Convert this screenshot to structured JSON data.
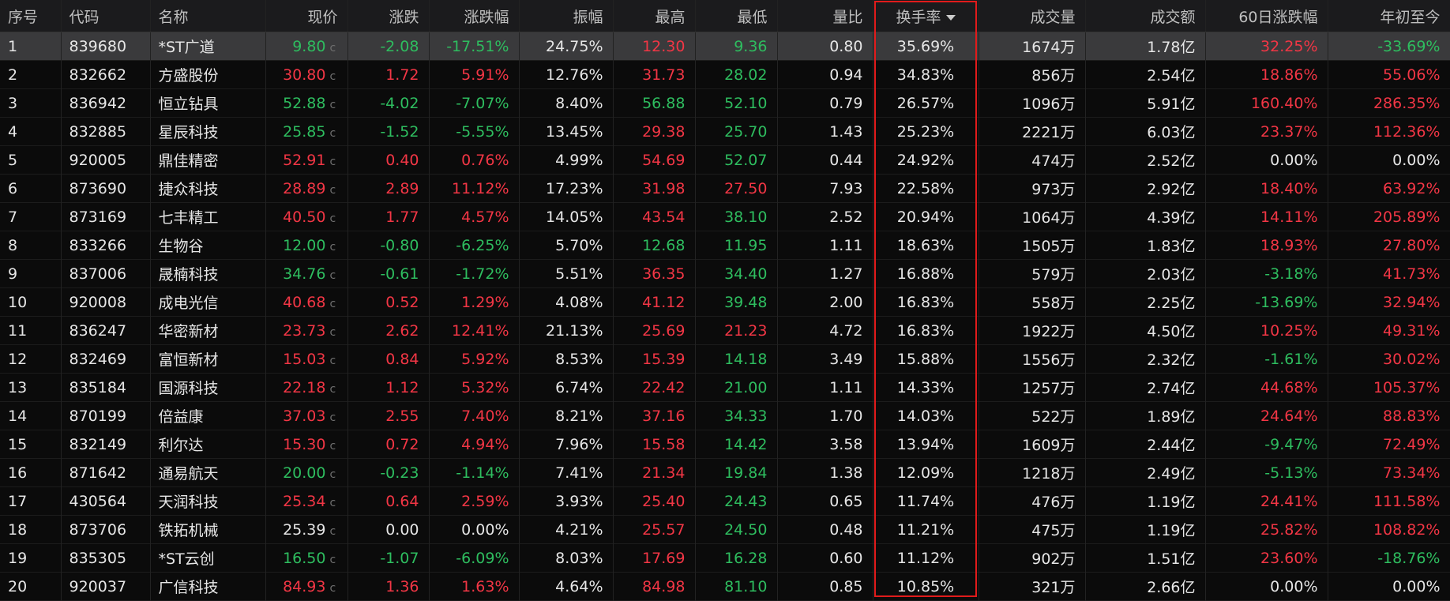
{
  "columns": {
    "idx": "序号",
    "code": "代码",
    "name": "名称",
    "price": "现价",
    "change": "涨跌",
    "change_pct": "涨跌幅",
    "amplitude": "振幅",
    "high": "最高",
    "low": "最低",
    "vol_ratio": "量比",
    "turnover": "换手率",
    "volume": "成交量",
    "amount": "成交额",
    "chg60": "60日涨跌幅",
    "ytd": "年初至今"
  },
  "sorted_column": "turnover",
  "sort_direction": "desc",
  "colors": {
    "up": "#f23645",
    "down": "#2ebd5f",
    "flat": "#e6e6e6",
    "highlight_box": "#e11b1b"
  },
  "rows": [
    {
      "idx": "1",
      "code": "839680",
      "name": "*ST广道",
      "price": "9.80",
      "price_tag": "c",
      "change": "-2.08",
      "change_pct": "-17.51%",
      "amplitude": "24.75%",
      "high": "12.30",
      "low": "9.36",
      "vol_ratio": "0.80",
      "turnover": "35.69%",
      "volume": "1674万",
      "amount": "1.78亿",
      "chg60": "32.25%",
      "ytd": "-33.69%"
    },
    {
      "idx": "2",
      "code": "832662",
      "name": "方盛股份",
      "price": "30.80",
      "price_tag": "c",
      "change": "1.72",
      "change_pct": "5.91%",
      "amplitude": "12.76%",
      "high": "31.73",
      "low": "28.02",
      "vol_ratio": "0.94",
      "turnover": "34.83%",
      "volume": "856万",
      "amount": "2.54亿",
      "chg60": "18.86%",
      "ytd": "55.06%"
    },
    {
      "idx": "3",
      "code": "836942",
      "name": "恒立钻具",
      "price": "52.88",
      "price_tag": "c",
      "change": "-4.02",
      "change_pct": "-7.07%",
      "amplitude": "8.40%",
      "high": "56.88",
      "low": "52.10",
      "vol_ratio": "0.79",
      "turnover": "26.57%",
      "volume": "1096万",
      "amount": "5.91亿",
      "chg60": "160.40%",
      "ytd": "286.35%"
    },
    {
      "idx": "4",
      "code": "832885",
      "name": "星辰科技",
      "price": "25.85",
      "price_tag": "c",
      "change": "-1.52",
      "change_pct": "-5.55%",
      "amplitude": "13.45%",
      "high": "29.38",
      "low": "25.70",
      "vol_ratio": "1.43",
      "turnover": "25.23%",
      "volume": "2221万",
      "amount": "6.03亿",
      "chg60": "23.37%",
      "ytd": "112.36%"
    },
    {
      "idx": "5",
      "code": "920005",
      "name": "鼎佳精密",
      "price": "52.91",
      "price_tag": "c",
      "change": "0.40",
      "change_pct": "0.76%",
      "amplitude": "4.99%",
      "high": "54.69",
      "low": "52.07",
      "vol_ratio": "0.44",
      "turnover": "24.92%",
      "volume": "474万",
      "amount": "2.52亿",
      "chg60": "0.00%",
      "ytd": "0.00%"
    },
    {
      "idx": "6",
      "code": "873690",
      "name": "捷众科技",
      "price": "28.89",
      "price_tag": "c",
      "change": "2.89",
      "change_pct": "11.12%",
      "amplitude": "17.23%",
      "high": "31.98",
      "low": "27.50",
      "vol_ratio": "7.93",
      "turnover": "22.58%",
      "volume": "973万",
      "amount": "2.92亿",
      "chg60": "18.40%",
      "ytd": "63.92%"
    },
    {
      "idx": "7",
      "code": "873169",
      "name": "七丰精工",
      "price": "40.50",
      "price_tag": "c",
      "change": "1.77",
      "change_pct": "4.57%",
      "amplitude": "14.05%",
      "high": "43.54",
      "low": "38.10",
      "vol_ratio": "2.52",
      "turnover": "20.94%",
      "volume": "1064万",
      "amount": "4.39亿",
      "chg60": "14.11%",
      "ytd": "205.89%"
    },
    {
      "idx": "8",
      "code": "833266",
      "name": "生物谷",
      "price": "12.00",
      "price_tag": "c",
      "change": "-0.80",
      "change_pct": "-6.25%",
      "amplitude": "5.70%",
      "high": "12.68",
      "low": "11.95",
      "vol_ratio": "1.11",
      "turnover": "18.63%",
      "volume": "1505万",
      "amount": "1.83亿",
      "chg60": "18.93%",
      "ytd": "27.80%"
    },
    {
      "idx": "9",
      "code": "837006",
      "name": "晟楠科技",
      "price": "34.76",
      "price_tag": "c",
      "change": "-0.61",
      "change_pct": "-1.72%",
      "amplitude": "5.51%",
      "high": "36.35",
      "low": "34.40",
      "vol_ratio": "1.27",
      "turnover": "16.88%",
      "volume": "579万",
      "amount": "2.03亿",
      "chg60": "-3.18%",
      "ytd": "41.73%"
    },
    {
      "idx": "10",
      "code": "920008",
      "name": "成电光信",
      "price": "40.68",
      "price_tag": "c",
      "change": "0.52",
      "change_pct": "1.29%",
      "amplitude": "4.08%",
      "high": "41.12",
      "low": "39.48",
      "vol_ratio": "2.00",
      "turnover": "16.83%",
      "volume": "558万",
      "amount": "2.25亿",
      "chg60": "-13.69%",
      "ytd": "32.94%"
    },
    {
      "idx": "11",
      "code": "836247",
      "name": "华密新材",
      "price": "23.73",
      "price_tag": "c",
      "change": "2.62",
      "change_pct": "12.41%",
      "amplitude": "21.13%",
      "high": "25.69",
      "low": "21.23",
      "vol_ratio": "4.72",
      "turnover": "16.83%",
      "volume": "1922万",
      "amount": "4.50亿",
      "chg60": "10.25%",
      "ytd": "49.31%"
    },
    {
      "idx": "12",
      "code": "832469",
      "name": "富恒新材",
      "price": "15.03",
      "price_tag": "c",
      "change": "0.84",
      "change_pct": "5.92%",
      "amplitude": "8.53%",
      "high": "15.39",
      "low": "14.18",
      "vol_ratio": "3.49",
      "turnover": "15.88%",
      "volume": "1556万",
      "amount": "2.32亿",
      "chg60": "-1.61%",
      "ytd": "30.02%"
    },
    {
      "idx": "13",
      "code": "835184",
      "name": "国源科技",
      "price": "22.18",
      "price_tag": "c",
      "change": "1.12",
      "change_pct": "5.32%",
      "amplitude": "6.74%",
      "high": "22.42",
      "low": "21.00",
      "vol_ratio": "1.11",
      "turnover": "14.33%",
      "volume": "1257万",
      "amount": "2.74亿",
      "chg60": "44.68%",
      "ytd": "105.37%"
    },
    {
      "idx": "14",
      "code": "870199",
      "name": "倍益康",
      "price": "37.03",
      "price_tag": "c",
      "change": "2.55",
      "change_pct": "7.40%",
      "amplitude": "8.21%",
      "high": "37.16",
      "low": "34.33",
      "vol_ratio": "1.70",
      "turnover": "14.03%",
      "volume": "522万",
      "amount": "1.89亿",
      "chg60": "24.64%",
      "ytd": "88.83%"
    },
    {
      "idx": "15",
      "code": "832149",
      "name": "利尔达",
      "price": "15.30",
      "price_tag": "c",
      "change": "0.72",
      "change_pct": "4.94%",
      "amplitude": "7.96%",
      "high": "15.58",
      "low": "14.42",
      "vol_ratio": "3.58",
      "turnover": "13.94%",
      "volume": "1609万",
      "amount": "2.44亿",
      "chg60": "-9.47%",
      "ytd": "72.49%"
    },
    {
      "idx": "16",
      "code": "871642",
      "name": "通易航天",
      "price": "20.00",
      "price_tag": "c",
      "change": "-0.23",
      "change_pct": "-1.14%",
      "amplitude": "7.41%",
      "high": "21.34",
      "low": "19.84",
      "vol_ratio": "1.38",
      "turnover": "12.09%",
      "volume": "1218万",
      "amount": "2.49亿",
      "chg60": "-5.13%",
      "ytd": "73.34%"
    },
    {
      "idx": "17",
      "code": "430564",
      "name": "天润科技",
      "price": "25.34",
      "price_tag": "c",
      "change": "0.64",
      "change_pct": "2.59%",
      "amplitude": "3.93%",
      "high": "25.40",
      "low": "24.43",
      "vol_ratio": "0.65",
      "turnover": "11.74%",
      "volume": "476万",
      "amount": "1.19亿",
      "chg60": "24.41%",
      "ytd": "111.58%"
    },
    {
      "idx": "18",
      "code": "873706",
      "name": "铁拓机械",
      "price": "25.39",
      "price_tag": "c",
      "change": "0.00",
      "change_pct": "0.00%",
      "amplitude": "4.21%",
      "high": "25.57",
      "low": "24.50",
      "vol_ratio": "0.48",
      "turnover": "11.21%",
      "volume": "475万",
      "amount": "1.19亿",
      "chg60": "25.82%",
      "ytd": "108.82%"
    },
    {
      "idx": "19",
      "code": "835305",
      "name": "*ST云创",
      "price": "16.50",
      "price_tag": "c",
      "change": "-1.07",
      "change_pct": "-6.09%",
      "amplitude": "8.03%",
      "high": "17.69",
      "low": "16.28",
      "vol_ratio": "0.60",
      "turnover": "11.12%",
      "volume": "902万",
      "amount": "1.51亿",
      "chg60": "23.60%",
      "ytd": "-18.76%"
    },
    {
      "idx": "20",
      "code": "920037",
      "name": "广信科技",
      "price": "84.93",
      "price_tag": "c",
      "change": "1.36",
      "change_pct": "1.63%",
      "amplitude": "4.64%",
      "high": "84.98",
      "low": "81.10",
      "vol_ratio": "0.85",
      "turnover": "10.85%",
      "volume": "321万",
      "amount": "2.66亿",
      "chg60": "0.00%",
      "ytd": "0.00%"
    }
  ]
}
